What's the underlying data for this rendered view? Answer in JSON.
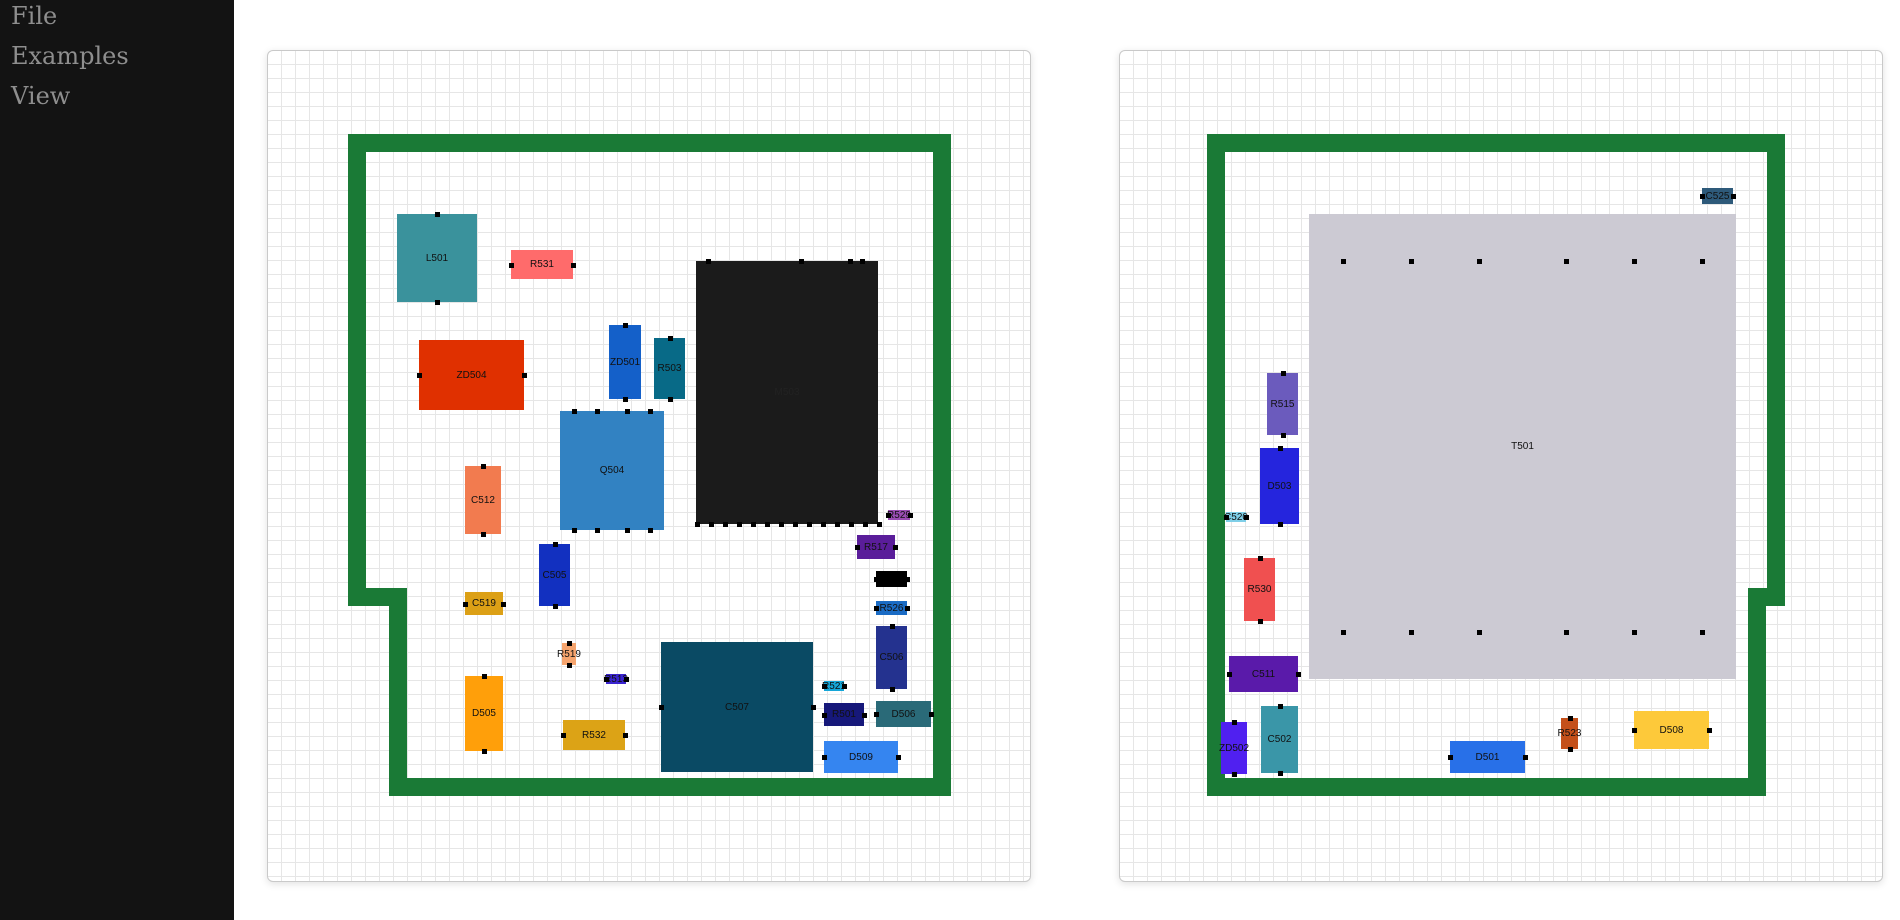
{
  "menu": {
    "items": [
      {
        "label": "File"
      },
      {
        "label": "Examples"
      },
      {
        "label": "View"
      }
    ]
  },
  "colors": {
    "sidebar_bg": "#131313",
    "menu_text": "#8e8e8e",
    "board_outline": "#1a7a36",
    "grid_line": "#e6e6e6"
  },
  "left_board": {
    "components": [
      {
        "label": "L501",
        "color": "#3a929c"
      },
      {
        "label": "R531",
        "color": "#ff6b6b"
      },
      {
        "label": "ZD504",
        "color": "#e03000"
      },
      {
        "label": "ZD501",
        "color": "#1460c9"
      },
      {
        "label": "R503",
        "color": "#086a87"
      },
      {
        "label": "M503",
        "color": "#1b1b1b"
      },
      {
        "label": "Q504",
        "color": "#3282c2"
      },
      {
        "label": "C512",
        "color": "#f27b4f"
      },
      {
        "label": "C505",
        "color": "#1230c0"
      },
      {
        "label": "R529",
        "color": "#9b4db3"
      },
      {
        "label": "R517",
        "color": "#5a1d9a"
      },
      {
        "label": "",
        "color": "#000000"
      },
      {
        "label": "R526",
        "color": "#1a6bc4"
      },
      {
        "label": "C519",
        "color": "#dca016"
      },
      {
        "label": "R519",
        "color": "#f5a46e"
      },
      {
        "label": "C506",
        "color": "#24328f"
      },
      {
        "label": "R513",
        "color": "#3a24d0"
      },
      {
        "label": "C507",
        "color": "#0a4a64"
      },
      {
        "label": "R521",
        "color": "#15a6d8"
      },
      {
        "label": "D505",
        "color": "#ff9f0a"
      },
      {
        "label": "R532",
        "color": "#dca316"
      },
      {
        "label": "R501",
        "color": "#16187a"
      },
      {
        "label": "D506",
        "color": "#2a6a78"
      },
      {
        "label": "D509",
        "color": "#3585f0"
      }
    ]
  },
  "right_board": {
    "components": [
      {
        "label": "C525",
        "color": "#2e5a7a"
      },
      {
        "label": "T501",
        "color": "#cccad3"
      },
      {
        "label": "R515",
        "color": "#6b5bbd"
      },
      {
        "label": "D503",
        "color": "#2525dd"
      },
      {
        "label": "C520",
        "color": "#7fcfe8"
      },
      {
        "label": "R530",
        "color": "#f05050"
      },
      {
        "label": "C511",
        "color": "#5a1aaa"
      },
      {
        "label": "ZD502",
        "color": "#5020f0"
      },
      {
        "label": "C502",
        "color": "#3a96a8"
      },
      {
        "label": "D501",
        "color": "#2870e8"
      },
      {
        "label": "R523",
        "color": "#c4501a"
      },
      {
        "label": "D508",
        "color": "#fdc93a"
      }
    ]
  }
}
